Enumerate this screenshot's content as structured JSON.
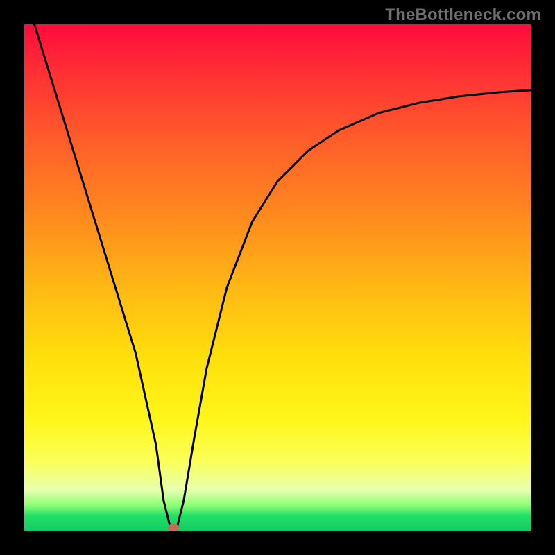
{
  "watermark": "TheBottleneck.com",
  "chart_data": {
    "type": "line",
    "title": "",
    "xlabel": "",
    "ylabel": "",
    "xlim": [
      0,
      100
    ],
    "ylim": [
      0,
      100
    ],
    "grid": false,
    "legend": false,
    "gradient_stops": [
      {
        "pos": 0,
        "color": "#ff0a3c"
      },
      {
        "pos": 8,
        "color": "#ff2a36"
      },
      {
        "pos": 22,
        "color": "#ff5a2a"
      },
      {
        "pos": 38,
        "color": "#ff8a1e"
      },
      {
        "pos": 52,
        "color": "#ffb814"
      },
      {
        "pos": 66,
        "color": "#ffe00c"
      },
      {
        "pos": 78,
        "color": "#fff61a"
      },
      {
        "pos": 86,
        "color": "#fbff55"
      },
      {
        "pos": 92,
        "color": "#e8ffb0"
      },
      {
        "pos": 95,
        "color": "#8cff72"
      },
      {
        "pos": 97,
        "color": "#22e06a"
      },
      {
        "pos": 100,
        "color": "#15c962"
      }
    ],
    "series": [
      {
        "name": "bottleneck-curve",
        "x": [
          2,
          6,
          10,
          14,
          18,
          22,
          26,
          27.5,
          29,
          30,
          31.5,
          33.5,
          36,
          40,
          45,
          50,
          56,
          62,
          70,
          78,
          86,
          94,
          100
        ],
        "y": [
          100,
          87,
          74,
          61,
          48,
          35,
          17,
          6,
          0,
          0,
          6,
          18,
          32,
          48,
          61,
          69,
          75,
          79,
          82.5,
          84.5,
          85.8,
          86.6,
          87
        ]
      }
    ],
    "marker": {
      "x": 29.5,
      "y": 0.5,
      "color": "#c46a5b"
    }
  }
}
